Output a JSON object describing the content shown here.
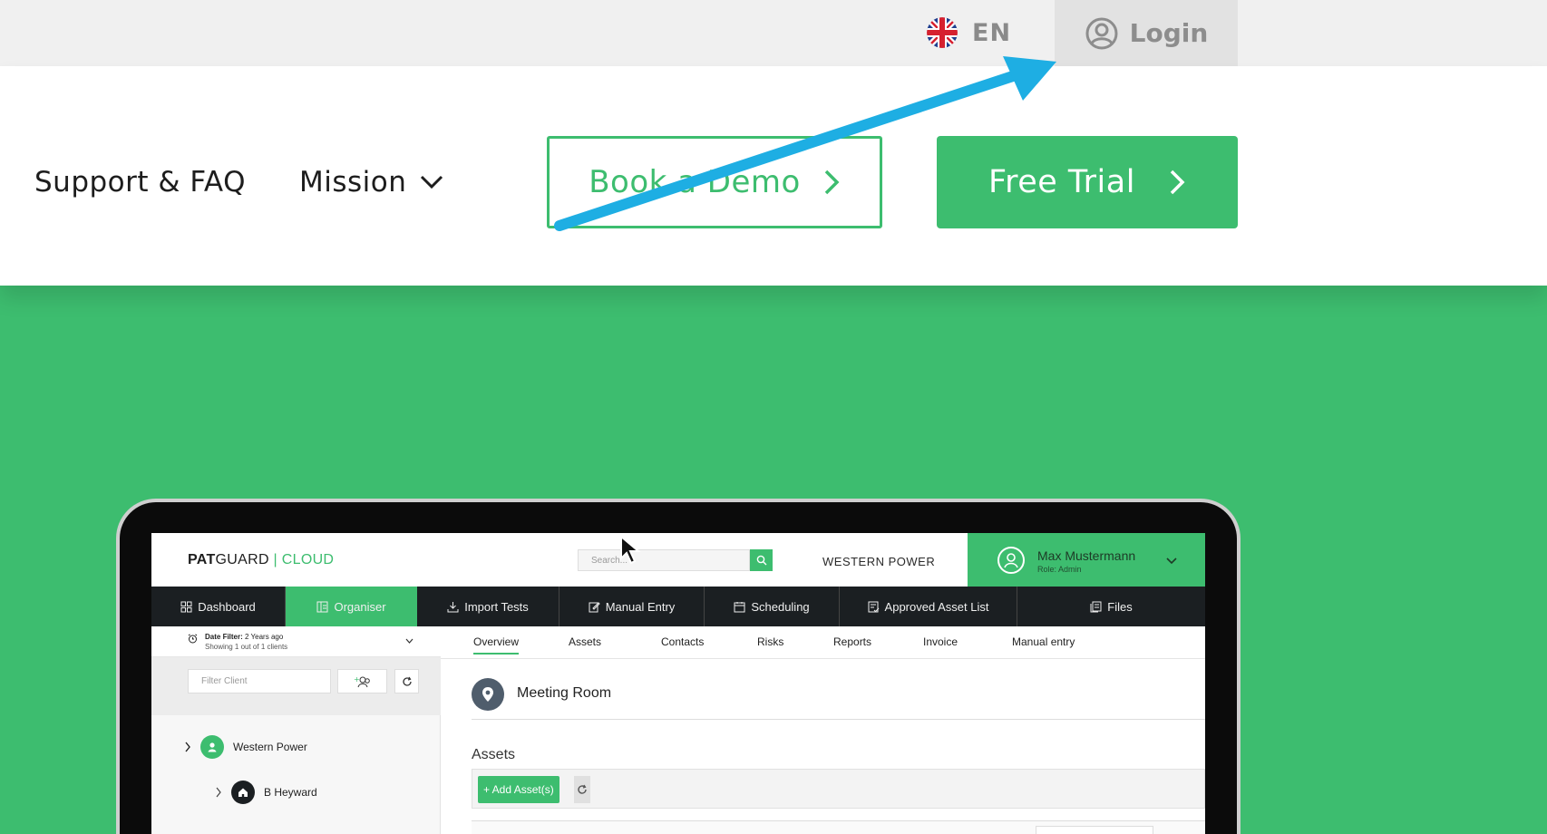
{
  "topbar": {
    "language": {
      "code": "EN",
      "flag_icon": "uk-flag-icon"
    },
    "login": {
      "label": "Login",
      "icon": "user-circle-icon"
    }
  },
  "nav": {
    "support": "Support & FAQ",
    "mission": "Mission",
    "book_demo": "Book a Demo",
    "free_trial": "Free Trial"
  },
  "colors": {
    "brand_green": "#3dbd6f",
    "annotation_arrow": "#1eaee3",
    "menu_dark": "#1b1f22"
  },
  "app": {
    "logo": {
      "part1": "PAT",
      "part2": "GUARD",
      "separator": " | ",
      "part3": "CLOUD"
    },
    "search_placeholder": "Search...",
    "client_name": "WESTERN POWER",
    "user": {
      "name": "Max Mustermann",
      "role": "Role: Admin"
    },
    "menu": [
      {
        "label": "Dashboard",
        "icon": "grid-icon"
      },
      {
        "label": "Organiser",
        "icon": "organiser-icon",
        "active": true
      },
      {
        "label": "Import Tests",
        "icon": "download-icon"
      },
      {
        "label": "Manual Entry",
        "icon": "edit-icon"
      },
      {
        "label": "Scheduling",
        "icon": "calendar-icon"
      },
      {
        "label": "Approved Asset List",
        "icon": "checklist-icon"
      },
      {
        "label": "Files",
        "icon": "files-icon"
      }
    ],
    "date_filter": {
      "label": "Date Filter:",
      "value": "2 Years ago",
      "sub": "Showing 1 out of 1 clients"
    },
    "filter_placeholder": "Filter Client",
    "tree": [
      {
        "label": "Western Power",
        "icon": "user-icon"
      },
      {
        "label": "B Heyward",
        "icon": "home-icon"
      }
    ],
    "tabs": [
      "Overview",
      "Assets",
      "Contacts",
      "Risks",
      "Reports",
      "Invoice",
      "Manual entry"
    ],
    "active_tab": "Overview",
    "room_title": "Meeting Room",
    "assets_title": "Assets",
    "add_assets_label": "+ Add Asset(s)"
  }
}
